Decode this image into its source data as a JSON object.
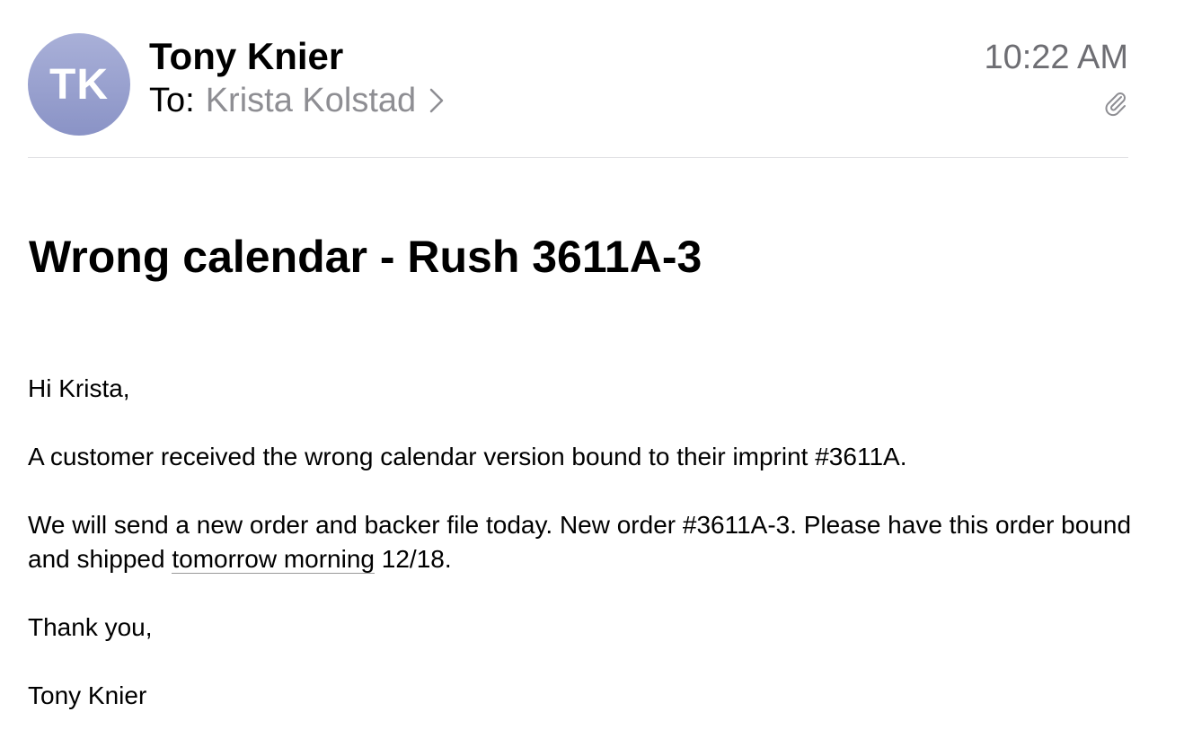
{
  "header": {
    "avatar_initials": "TK",
    "sender_name": "Tony Knier",
    "to_label": "To:",
    "recipient": "Krista Kolstad",
    "time": "10:22 AM"
  },
  "icons": {
    "chevron": "chevron-right-icon",
    "attachment": "paperclip-icon"
  },
  "colors": {
    "avatar": "#9aa1cf",
    "secondary_text": "#8e8e93",
    "divider": "#e0e0e3"
  },
  "subject": "Wrong calendar - Rush 3611A-3",
  "body": {
    "greeting": "Hi Krista,",
    "paragraph1": "A customer received the wrong calendar version bound to their imprint #3611A.",
    "paragraph2_start": "We will send a new order and backer file today. New order #3611A-3. Please have this order bound and shipped ",
    "paragraph2_link": "tomorrow morning",
    "paragraph2_end": " 12/18.",
    "closing": "Thank you,",
    "signature": "Tony Knier"
  }
}
